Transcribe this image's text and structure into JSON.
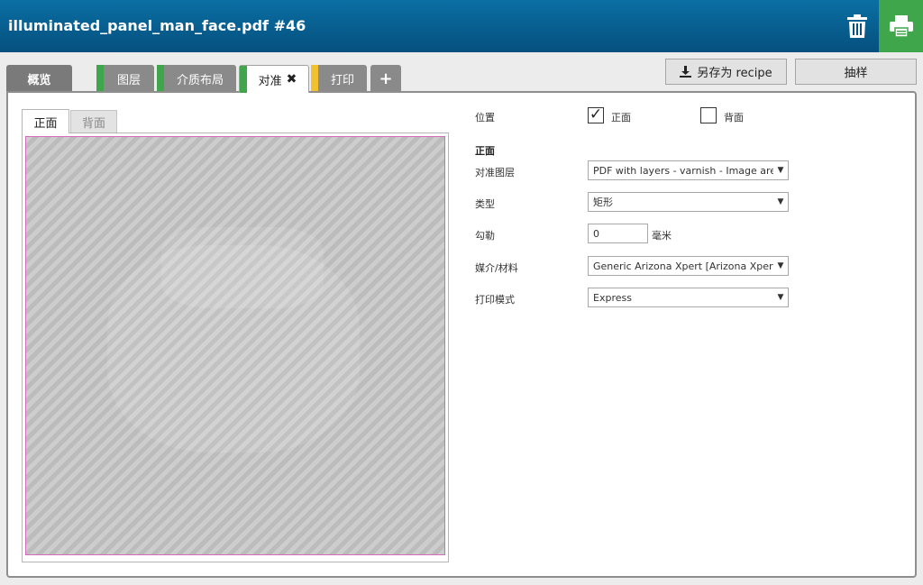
{
  "header": {
    "title": "illuminated_panel_man_face.pdf #46",
    "print_btn_color": "#3fa64b"
  },
  "tabs": {
    "overview": "概览",
    "layers": "图层",
    "media_layout": "介质布局",
    "alignment": "对准",
    "print": "打印",
    "add": "+",
    "stripe_colors": {
      "layers": "#3fa64b",
      "media_layout": "#3fa64b",
      "alignment": "#3fa64b",
      "print": "#f2c12e"
    }
  },
  "toolbar": {
    "save_recipe": "另存为 recipe",
    "sample": "抽样"
  },
  "preview": {
    "front_tab": "正面",
    "back_tab": "背面"
  },
  "form": {
    "position_label": "位置",
    "front_checkbox_label": "正面",
    "front_checked": true,
    "back_checkbox_label": "背面",
    "back_checked": false,
    "section_title": "正面",
    "align_image_label": "对准图层",
    "align_image_value": "PDF with layers - varnish - Image area varnish",
    "type_label": "类型",
    "type_value": "矩形",
    "outline_label": "勾勒",
    "outline_value": "0",
    "outline_unit": "毫米",
    "media_label": "媒介/材料",
    "media_value": "Generic Arizona Xpert [Arizona Xpert]",
    "print_mode_label": "打印模式",
    "print_mode_value": "Express"
  }
}
